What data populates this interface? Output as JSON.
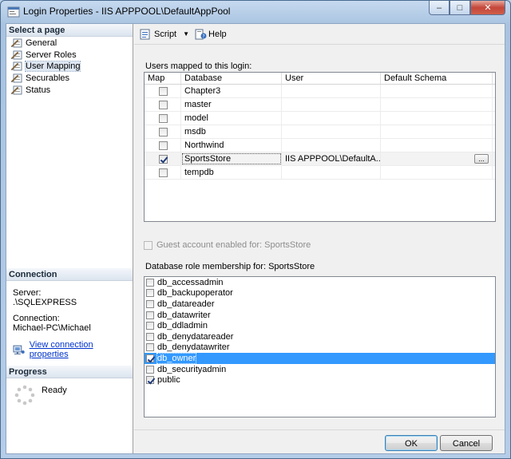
{
  "window": {
    "title": "Login Properties - IIS APPPOOL\\DefaultAppPool",
    "minimize": "–",
    "maximize": "□",
    "close": "✕"
  },
  "left": {
    "select_page_header": "Select a page",
    "pages": [
      {
        "label": "General",
        "icon": "wrench-page-icon"
      },
      {
        "label": "Server Roles",
        "icon": "wrench-page-icon"
      },
      {
        "label": "User Mapping",
        "icon": "wrench-page-icon",
        "selected": true
      },
      {
        "label": "Securables",
        "icon": "wrench-page-icon"
      },
      {
        "label": "Status",
        "icon": "wrench-page-icon"
      }
    ],
    "connection_header": "Connection",
    "server_label": "Server:",
    "server_value": ".\\SQLEXPRESS",
    "connection_label": "Connection:",
    "connection_value": "Michael-PC\\Michael",
    "view_link": "View connection properties",
    "progress_header": "Progress",
    "progress_status": "Ready"
  },
  "toolbar": {
    "script_label": "Script",
    "help_label": "Help"
  },
  "mapping": {
    "caption": "Users mapped to this login:",
    "columns": [
      "Map",
      "Database",
      "User",
      "Default Schema"
    ],
    "rows": [
      {
        "map": false,
        "database": "Chapter3",
        "user": "",
        "schema": ""
      },
      {
        "map": false,
        "database": "master",
        "user": "",
        "schema": ""
      },
      {
        "map": false,
        "database": "model",
        "user": "",
        "schema": ""
      },
      {
        "map": false,
        "database": "msdb",
        "user": "",
        "schema": ""
      },
      {
        "map": false,
        "database": "Northwind",
        "user": "",
        "schema": ""
      },
      {
        "map": true,
        "database": "SportsStore",
        "user": "IIS APPPOOL\\DefaultA...",
        "schema": "",
        "selected": true,
        "ellipsis": "..."
      },
      {
        "map": false,
        "database": "tempdb",
        "user": "",
        "schema": ""
      }
    ]
  },
  "guest": {
    "label": "Guest account enabled for: SportsStore",
    "checked": false,
    "disabled": true
  },
  "roles": {
    "caption": "Database role membership for: SportsStore",
    "items": [
      {
        "label": "db_accessadmin",
        "checked": false
      },
      {
        "label": "db_backupoperator",
        "checked": false
      },
      {
        "label": "db_datareader",
        "checked": false
      },
      {
        "label": "db_datawriter",
        "checked": false
      },
      {
        "label": "db_ddladmin",
        "checked": false
      },
      {
        "label": "db_denydatareader",
        "checked": false
      },
      {
        "label": "db_denydatawriter",
        "checked": false
      },
      {
        "label": "db_owner",
        "checked": true,
        "selected": true
      },
      {
        "label": "db_securityadmin",
        "checked": false
      },
      {
        "label": "public",
        "checked": true
      }
    ]
  },
  "buttons": {
    "ok": "OK",
    "cancel": "Cancel"
  },
  "colors": {
    "selection": "#3399ff",
    "link": "#0033cc"
  }
}
